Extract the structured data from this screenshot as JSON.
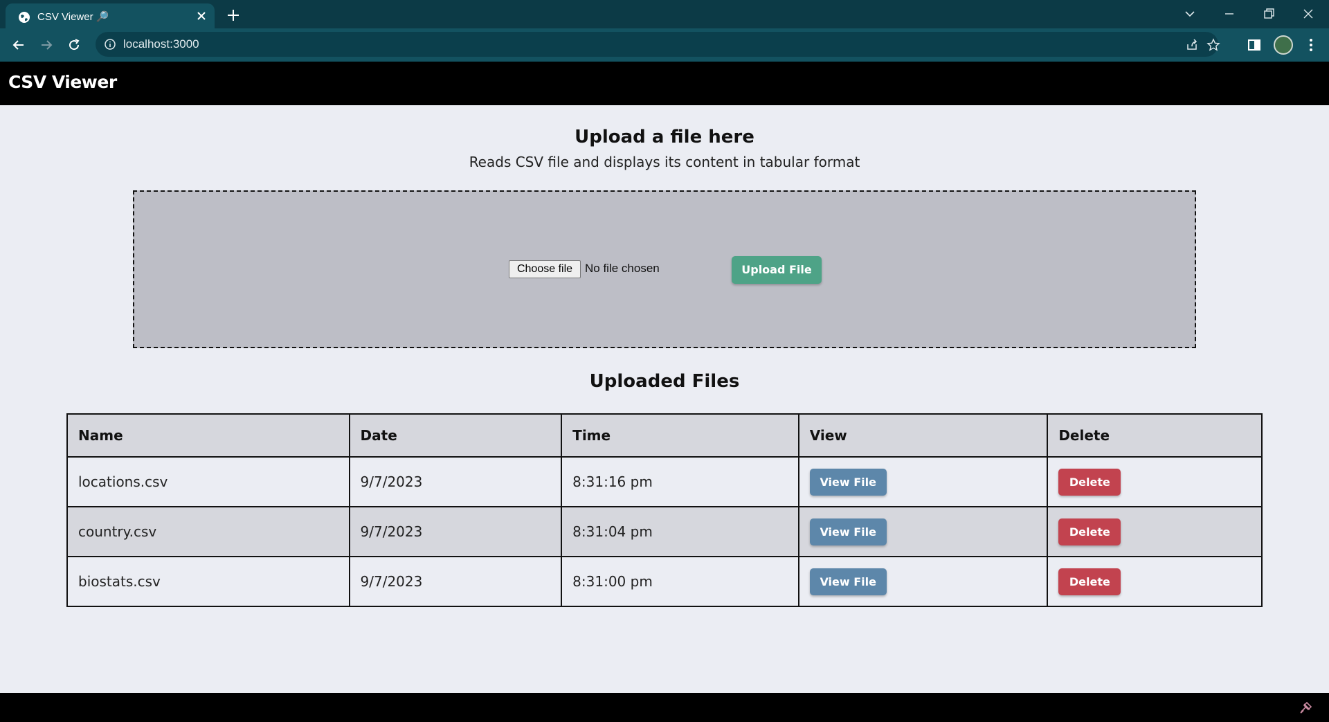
{
  "browser": {
    "tab_title": "CSV Viewer 🔎",
    "url": "localhost:3000"
  },
  "header": {
    "title": "CSV Viewer"
  },
  "upload": {
    "heading": "Upload a file here",
    "subheading": "Reads CSV file and displays its content in tabular format",
    "choose_label": "Choose file",
    "no_file_label": "No file chosen",
    "upload_label": "Upload File"
  },
  "files": {
    "heading": "Uploaded Files",
    "columns": [
      "Name",
      "Date",
      "Time",
      "View",
      "Delete"
    ],
    "view_label": "View File",
    "delete_label": "Delete",
    "rows": [
      {
        "name": "locations.csv",
        "date": "9/7/2023",
        "time": "8:31:16 pm"
      },
      {
        "name": "country.csv",
        "date": "9/7/2023",
        "time": "8:31:04 pm"
      },
      {
        "name": "biostats.csv",
        "date": "9/7/2023",
        "time": "8:31:00 pm"
      }
    ]
  },
  "colors": {
    "upload_button": "#4ea387",
    "view_button": "#5d87aa",
    "delete_button": "#c2434f",
    "header_bg": "#000000",
    "page_bg": "#ebedf3"
  },
  "icons": [
    "globe-icon",
    "close-icon",
    "plus-icon",
    "chevron-down-icon",
    "minimize-icon",
    "restore-icon",
    "back-icon",
    "forward-icon",
    "reload-icon",
    "info-icon",
    "share-icon",
    "star-icon",
    "sidepanel-icon",
    "avatar",
    "more-icon",
    "extension-icon"
  ]
}
